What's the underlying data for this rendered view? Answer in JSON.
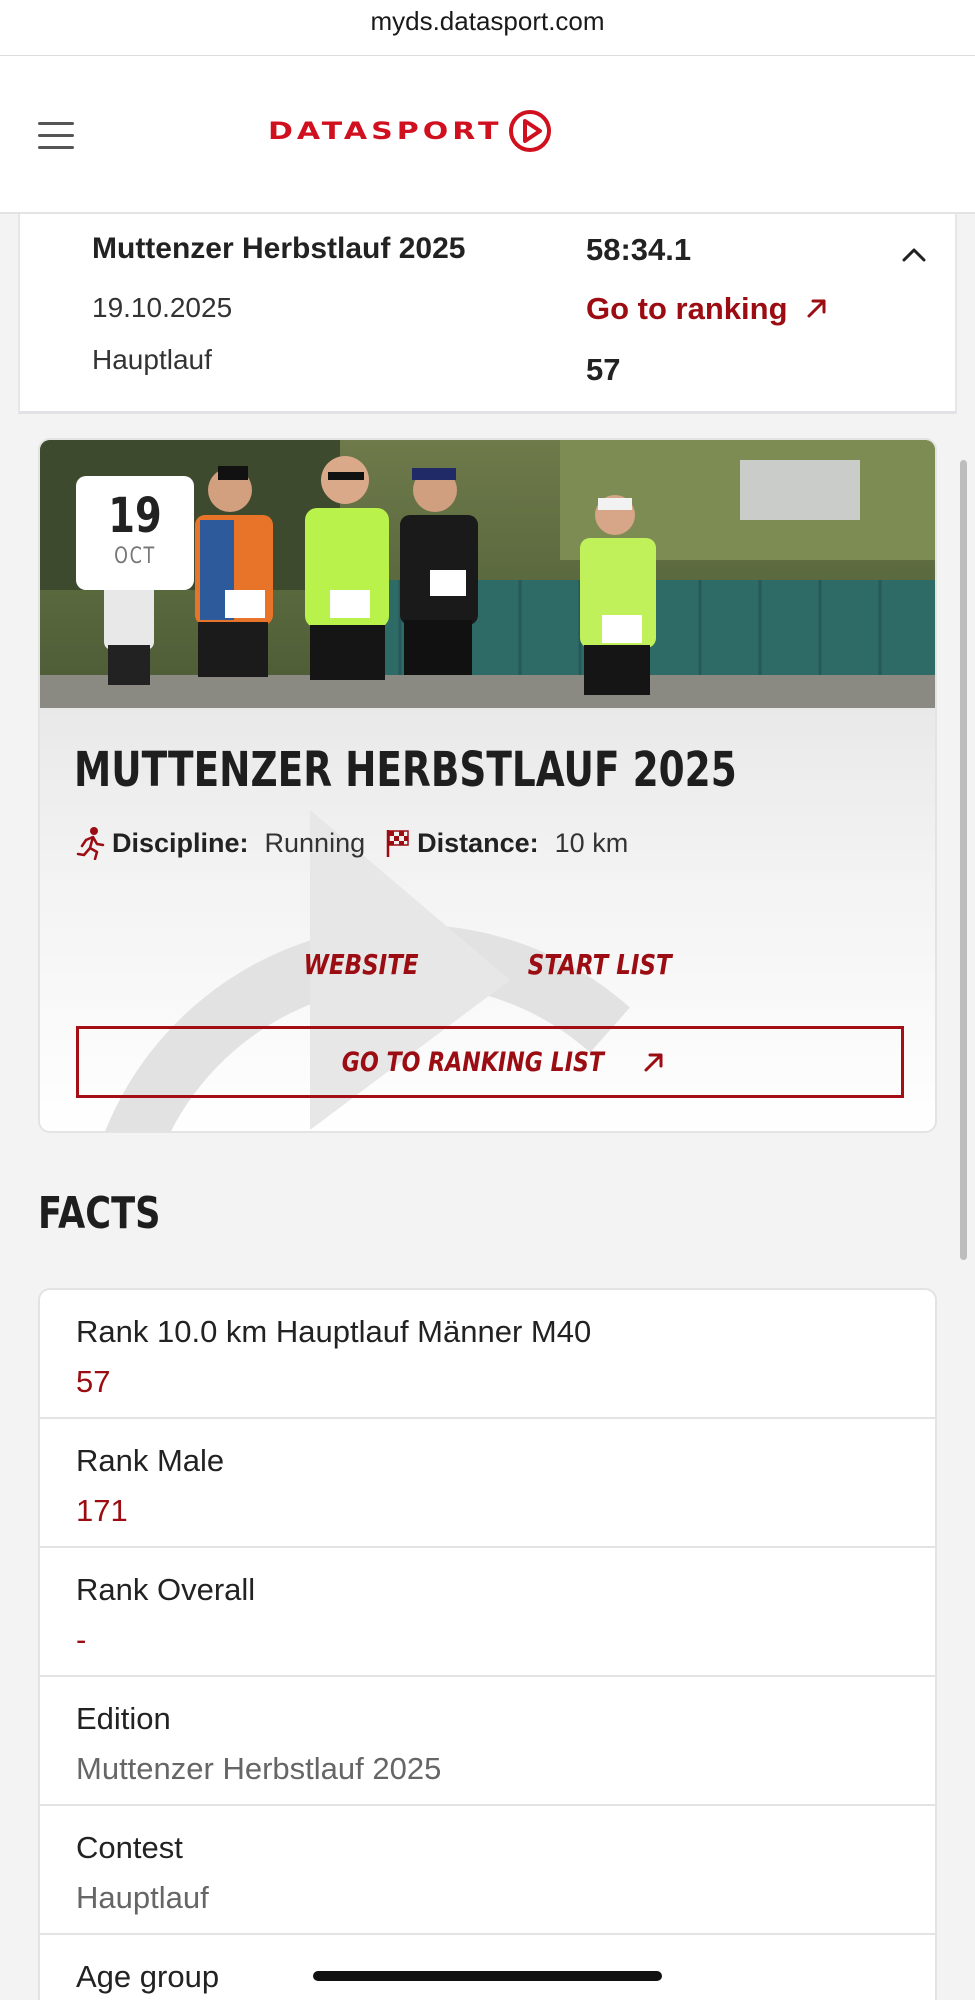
{
  "browser": {
    "url": "myds.datasport.com"
  },
  "header": {
    "logo_text": "DATASPORT"
  },
  "summary": {
    "title": "Muttenzer Herbstlauf 2025",
    "date": "19.10.2025",
    "contest": "Hauptlauf",
    "time": "58:34.1",
    "link_label": "Go to ranking",
    "rank": "57"
  },
  "event": {
    "day": "19",
    "month": "OCT",
    "title": "MUTTENZER HERBSTLAUF 2025",
    "discipline_label": "Discipline:",
    "discipline_value": "Running",
    "distance_label": "Distance:",
    "distance_value": "10 km",
    "website_label": "WEBSITE",
    "startlist_label": "START LIST",
    "ranking_button_label": "GO TO RANKING LIST"
  },
  "facts": {
    "heading": "FACTS",
    "items": [
      {
        "label": "Rank 10.0 km Hauptlauf Männer M40",
        "value": "57"
      },
      {
        "label": "Rank Male",
        "value": "171"
      },
      {
        "label": "Rank Overall",
        "value": "-"
      },
      {
        "label": "Edition",
        "value": "Muttenzer Herbstlauf 2025"
      },
      {
        "label": "Contest",
        "value": "Hauptlauf"
      },
      {
        "label": "Age group",
        "value": ""
      }
    ]
  },
  "colors": {
    "brand_red": "#d0101e",
    "accent_dark_red": "#9b0d12"
  },
  "icons": [
    "menu-icon",
    "datasport-play-icon",
    "chevron-up-icon",
    "arrow-up-right-icon",
    "runner-icon",
    "checkered-flag-icon"
  ]
}
